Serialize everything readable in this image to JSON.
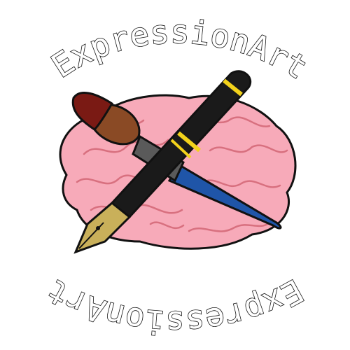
{
  "logo": {
    "top_text": "ExpressionArt",
    "bottom_text": "ExpressionArt",
    "icons": [
      "brain-icon",
      "paintbrush-icon",
      "fountain-pen-icon"
    ],
    "colors": {
      "background": "#ffffff",
      "brain": "#f7aab9",
      "brain_folds": "#d8707f",
      "brush_tip": "#7a1a14",
      "brush_wood": "#8a4a25",
      "pen_body": "#1a1a1a",
      "pen_trim": "#f2d21b",
      "pen_cap": "#1f55a8",
      "nib": "#c9b05a",
      "outline": "#111111"
    }
  }
}
